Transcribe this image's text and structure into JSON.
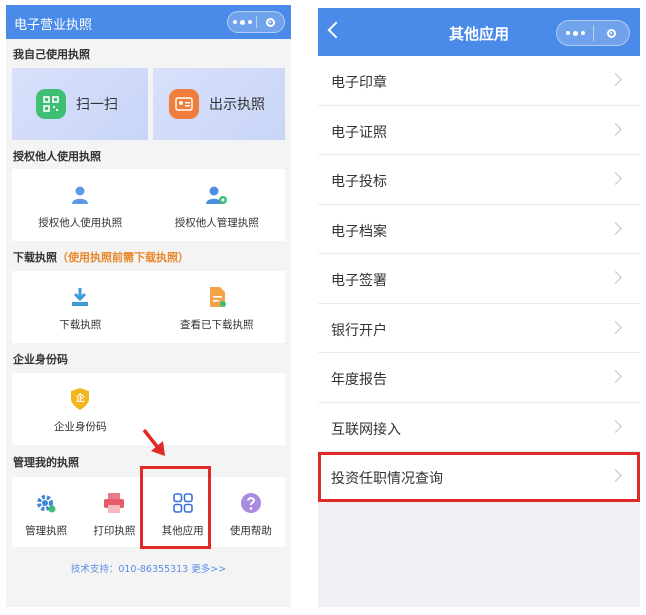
{
  "left": {
    "title": "电子营业执照",
    "sections": {
      "self": {
        "title": "我自己使用执照",
        "scan_label": "扫一扫",
        "show_label": "出示执照"
      },
      "auth": {
        "title": "授权他人使用执照",
        "auth_use_label": "授权他人使用执照",
        "auth_manage_label": "授权他人管理执照"
      },
      "download": {
        "title": "下载执照",
        "note": "（使用执照前需下载执照）",
        "download_label": "下载执照",
        "view_label": "查看已下载执照"
      },
      "enterprise": {
        "title": "企业身份码",
        "code_label": "企业身份码",
        "code_icon_text": "企"
      },
      "manage": {
        "title": "管理我的执照",
        "manage_label": "管理执照",
        "print_label": "打印执照",
        "other_label": "其他应用",
        "help_label": "使用帮助"
      }
    },
    "footer": "技术支持：010-86355313  更多>>"
  },
  "right": {
    "title": "其他应用",
    "items": [
      "电子印章",
      "电子证照",
      "电子投标",
      "电子档案",
      "电子签署",
      "银行开户",
      "年度报告",
      "互联网接入",
      "投资任职情况查询"
    ]
  },
  "colors": {
    "header": "#4a8ae8",
    "highlight": "#e02a2a",
    "note": "#e8882d",
    "link": "#5b8ee6"
  },
  "icons": {
    "scan": "qr-scan-icon",
    "show": "license-card-icon",
    "auth_use": "user-icon",
    "auth_manage": "user-gear-icon",
    "download": "download-icon",
    "view": "document-icon",
    "enterprise": "shield-icon",
    "manage": "gear-icon",
    "print": "printer-icon",
    "other": "grid-apps-icon",
    "help": "question-icon"
  }
}
